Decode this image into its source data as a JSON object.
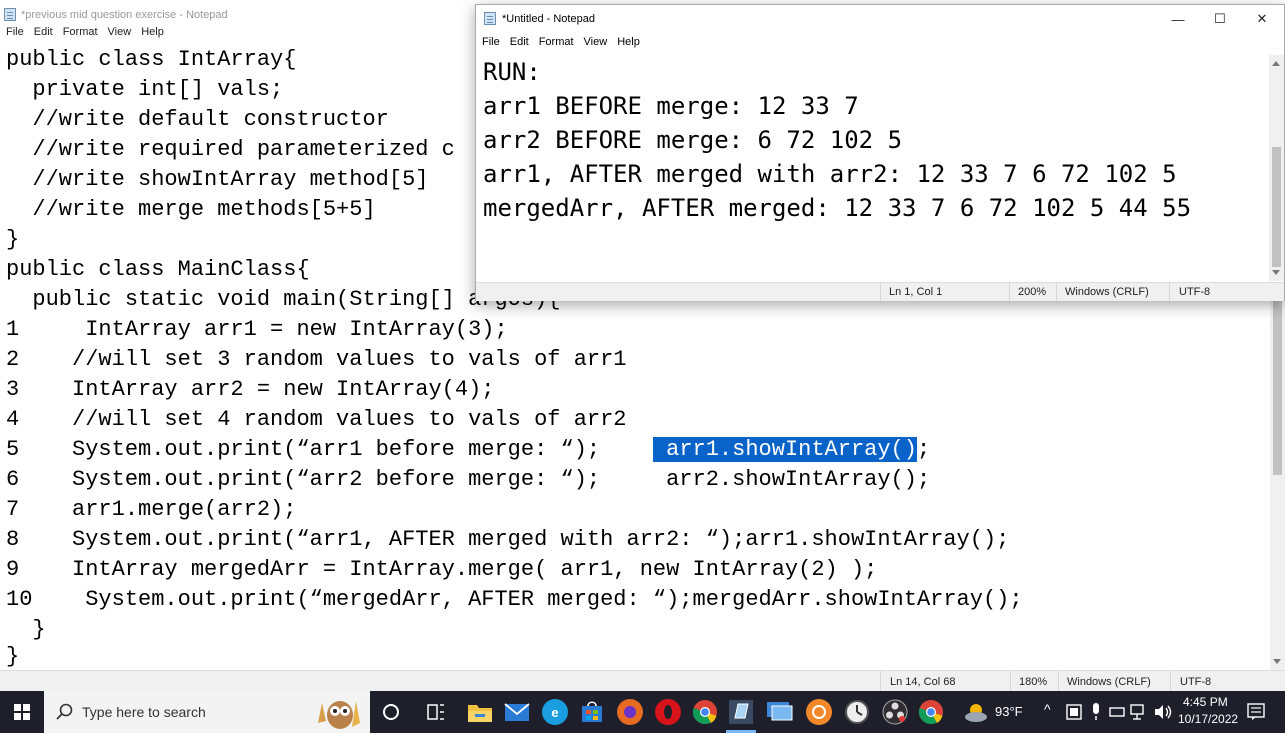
{
  "background_notepad": {
    "title": "*previous mid question exercise - Notepad",
    "menu": [
      "File",
      "Edit",
      "Format",
      "View",
      "Help"
    ],
    "code_lines": [
      "public class IntArray{",
      "  private int[] vals;",
      "  //write default constructor",
      "  //write required parameterized c",
      "  //write showIntArray method[5]",
      "  //write merge methods[5+5]",
      "}",
      "public class MainClass{",
      "  public static void main(String[] argos){",
      "1     IntArray arr1 = new IntArray(3);",
      "2    //will set 3 random values to vals of arr1",
      "3    IntArray arr2 = new IntArray(4);",
      "4    //will set 4 random values to vals of arr2",
      "5    System.out.print(“arr1 before merge: “);",
      "6    System.out.print(“arr2 before merge: “);     arr2.showIntArray();",
      "7    arr1.merge(arr2);",
      "8    System.out.print(“arr1, AFTER merged with arr2: “);arr1.showIntArray();",
      "9    IntArray mergedArr = IntArray.merge( arr1, new IntArray(2) );",
      "10    System.out.print(“mergedArr, AFTER merged: “);mergedArr.showIntArray();",
      "  }",
      "}"
    ],
    "line5_gap": "    ",
    "line5_selected": " arr1.showIntArray()",
    "line5_after": ";",
    "status": {
      "position": "Ln 14, Col 68",
      "zoom": "180%",
      "line_ending": "Windows (CRLF)",
      "encoding": "UTF-8"
    }
  },
  "front_notepad": {
    "title": "*Untitled - Notepad",
    "menu": [
      "File",
      "Edit",
      "Format",
      "View",
      "Help"
    ],
    "lines": [
      "RUN:",
      "arr1 BEFORE merge: 12 33 7",
      "arr2 BEFORE merge: 6 72 102 5",
      "arr1, AFTER merged with arr2: 12 33 7 6 72 102 5",
      "mergedArr, AFTER merged: 12 33 7 6 72 102 5 44 55"
    ],
    "status": {
      "position": "Ln 1, Col 1",
      "zoom": "200%",
      "line_ending": "Windows (CRLF)",
      "encoding": "UTF-8"
    },
    "window_buttons": {
      "minimize": "—",
      "maximize": "☐",
      "close": "✕"
    }
  },
  "taskbar": {
    "search_placeholder": "Type here to search",
    "weather": "93°F",
    "time": "4:45 PM",
    "date": "10/17/2022",
    "icons": [
      "start-icon",
      "search-icon",
      "cortana-icon",
      "task-view-icon",
      "file-explorer-icon",
      "mail-icon",
      "edge-icon",
      "store-icon",
      "firefox-icon",
      "opera-icon",
      "chrome-icon",
      "notepad-icon",
      "remote-desktop-icon",
      "app-orange-icon",
      "clock-app-icon",
      "obs-icon",
      "chrome-profile-icon",
      "notifications-icon"
    ]
  },
  "colors": {
    "selection": "#0a63c9",
    "taskbar_bg": "#1f1f2b",
    "status_bg": "#f0f0f0"
  }
}
